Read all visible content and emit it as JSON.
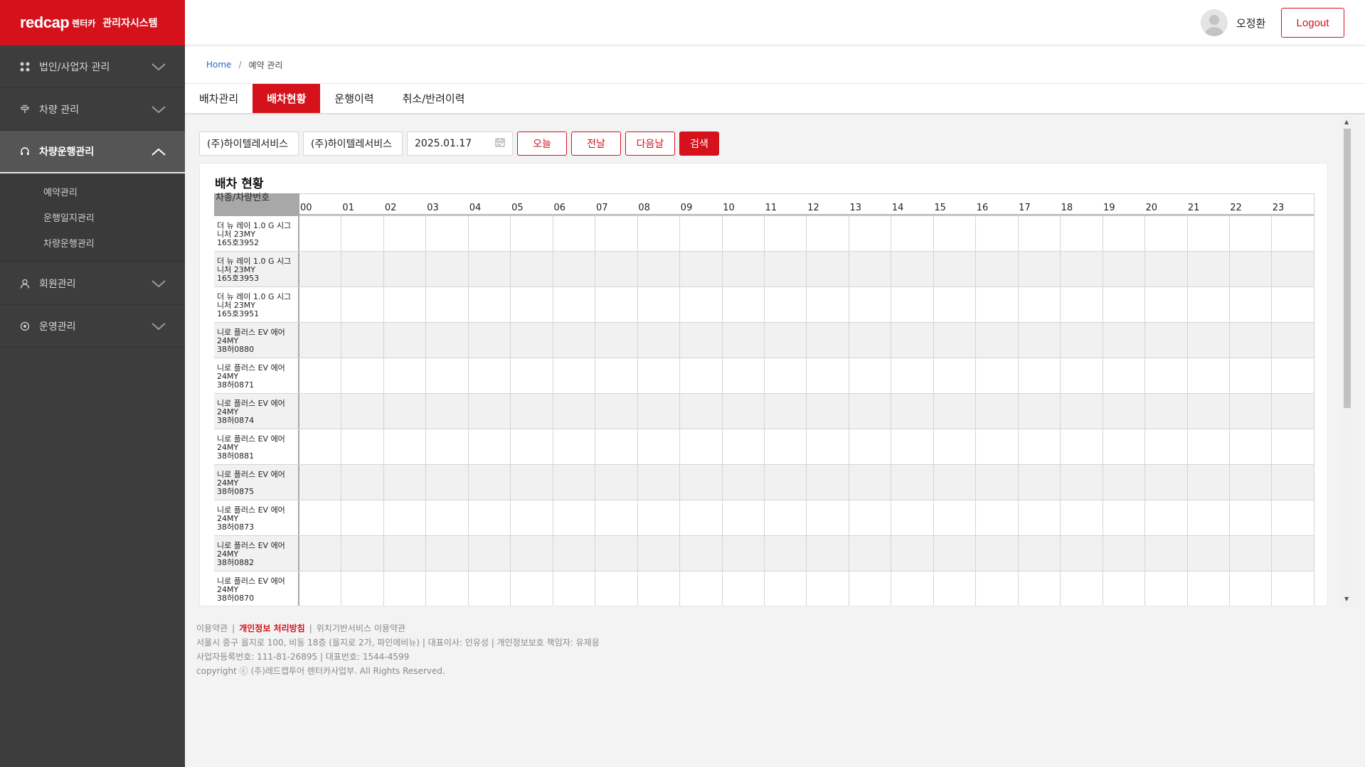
{
  "brand": {
    "logo": "redcap",
    "sub": "렌터카",
    "system": "관리자시스템"
  },
  "sidebar": {
    "items": [
      {
        "label": "법인/사업자 관리",
        "icon": "grid-icon",
        "expanded": false
      },
      {
        "label": "차량 관리",
        "icon": "car-icon",
        "expanded": false
      },
      {
        "label": "차량운행관리",
        "icon": "headset-icon",
        "expanded": true,
        "children": [
          "예약관리",
          "운행일지관리",
          "차량운행관리"
        ]
      },
      {
        "label": "회원관리",
        "icon": "user-icon",
        "expanded": false
      },
      {
        "label": "운영관리",
        "icon": "settings-circle-icon",
        "expanded": false
      }
    ]
  },
  "header": {
    "username": "오정환",
    "logout_label": "Logout"
  },
  "breadcrumb": {
    "home": "Home",
    "current": "예약 관리"
  },
  "tabs": [
    {
      "label": "배차관리",
      "active": false
    },
    {
      "label": "배차현황",
      "active": true
    },
    {
      "label": "운행이력",
      "active": false
    },
    {
      "label": "취소/반려이력",
      "active": false
    }
  ],
  "filters": {
    "company1": "(주)하이텔레서비스",
    "company2": "(주)하이텔레서비스",
    "date": "2025.01.17",
    "today_label": "오늘",
    "prev_label": "전날",
    "next_label": "다음날",
    "search_label": "검색"
  },
  "schedule": {
    "title": "배차 현황",
    "corner_label": "차종/차량번호",
    "hours": [
      "00",
      "01",
      "02",
      "03",
      "04",
      "05",
      "06",
      "07",
      "08",
      "09",
      "10",
      "11",
      "12",
      "13",
      "14",
      "15",
      "16",
      "17",
      "18",
      "19",
      "20",
      "21",
      "22",
      "23"
    ],
    "rows": [
      {
        "model": "더 뉴 레이 1.0 G 시그니처 23MY",
        "plate": "165호3952"
      },
      {
        "model": "더 뉴 레이 1.0 G 시그니처 23MY",
        "plate": "165호3953"
      },
      {
        "model": "더 뉴 레이 1.0 G 시그니처 23MY",
        "plate": "165호3951"
      },
      {
        "model": "니로 플러스 EV 에어 24MY",
        "plate": "38허0880"
      },
      {
        "model": "니로 플러스 EV 에어 24MY",
        "plate": "38허0871"
      },
      {
        "model": "니로 플러스 EV 에어 24MY",
        "plate": "38허0874"
      },
      {
        "model": "니로 플러스 EV 에어 24MY",
        "plate": "38허0881"
      },
      {
        "model": "니로 플러스 EV 에어 24MY",
        "plate": "38허0875"
      },
      {
        "model": "니로 플러스 EV 에어 24MY",
        "plate": "38허0873"
      },
      {
        "model": "니로 플러스 EV 에어 24MY",
        "plate": "38허0882"
      },
      {
        "model": "니로 플러스 EV 에어 24MY",
        "plate": "38허0870"
      }
    ]
  },
  "footer": {
    "links": [
      "이용약관",
      "개인정보 처리방침",
      "위치기반서비스 이용약관"
    ],
    "address": "서울시 중구 을지로 100, 비동 18층 (을지로 2가, 파인에비뉴) | 대표이사: 인유성 | 개인정보보호 책임자: 유제응",
    "biz": "사업자등록번호: 111-81-26895 | 대표번호: 1544-4599",
    "copyright": "copyright ⓒ (주)레드캡투어 렌터카사업부. All Rights Reserved."
  },
  "colors": {
    "accent": "#d5121c",
    "sidebar_bg": "#3d3d3d"
  }
}
